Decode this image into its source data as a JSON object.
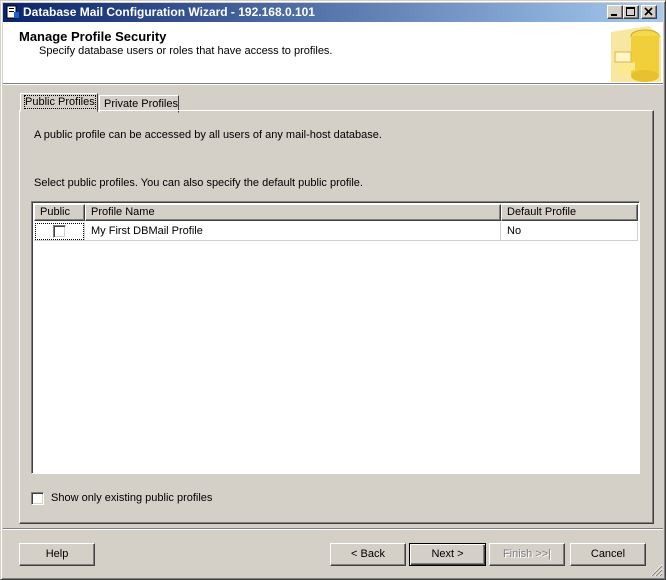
{
  "window": {
    "title": "Database Mail Configuration Wizard - 192.168.0.101",
    "minimize_icon": "minimize-icon",
    "maximize_icon": "maximize-icon",
    "close_icon": "close-icon"
  },
  "header": {
    "title": "Manage Profile Security",
    "subtitle": "Specify database users or roles that have access to profiles.",
    "graphic": "database-icon"
  },
  "tabs": [
    {
      "label": "Public Profiles",
      "active": true
    },
    {
      "label": "Private Profiles",
      "active": false
    }
  ],
  "panel": {
    "description": "A public profile can be accessed by all users of any mail-host database.",
    "instruction": "Select public profiles. You can also specify the default public profile."
  },
  "grid": {
    "columns": [
      "Public",
      "Profile Name",
      "Default Profile"
    ],
    "rows": [
      {
        "public": false,
        "profile_name": "My First DBMail Profile",
        "default_profile": "No"
      }
    ]
  },
  "show_existing": {
    "label": "Show only existing public profiles",
    "checked": false
  },
  "buttons": {
    "help": "Help",
    "back": "< Back",
    "next": "Next >",
    "finish": "Finish >>|",
    "cancel": "Cancel"
  },
  "colors": {
    "titlebar_start": "#0a246a",
    "titlebar_end": "#a6caf0",
    "face": "#d4d0c8",
    "accent_yellow": "#f5d94a"
  }
}
